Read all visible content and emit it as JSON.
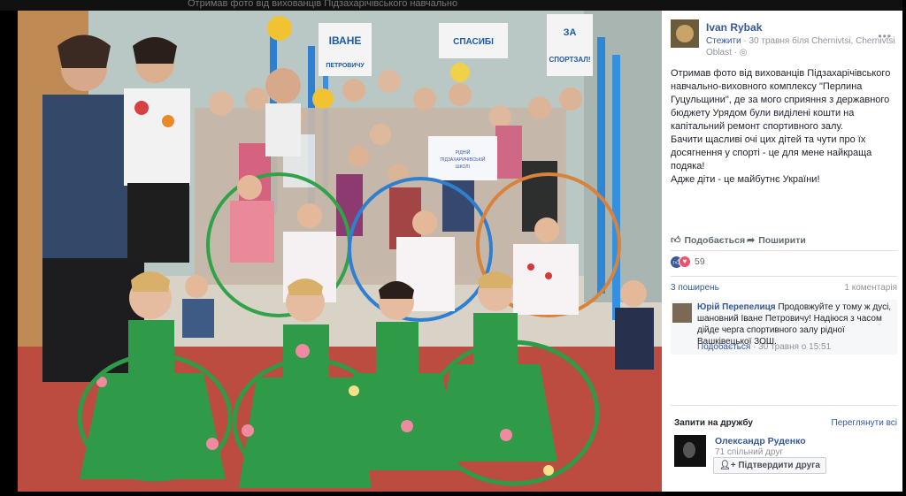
{
  "background_caption": "Отримав фото від вихованців Підзахарічівського навчально",
  "photo": {
    "signs": [
      "ІВАНЕ ПЕТРОВИЧУ",
      "СПАСИБІ",
      "ЗА СПОРТЗАЛ!"
    ],
    "small_sign": "РІДНІЙ ПІДЗАХАРИЧІВСЬКІЙ ШКОЛІ"
  },
  "post": {
    "author": "Ivan Rybak",
    "follow": "Стежити",
    "meta": "· 30 травня біля Chernivtsi, Chernivtsi Oblast ·",
    "paragraphs": [
      "Отримав фото від вихованців Підзахарічівського навчально-виховного комплексу \"Перлина Гуцульщини\", де за мого сприяння з державного бюджету Урядом були виділені кошти на капітальний ремонт спортивного залу.",
      "Бачити щасливі очі цих дітей та чути про їх досягнення у спорті - це для мене найкраща подяка!",
      "Адже діти - це майбутнє України!"
    ],
    "like_label": "Подобається",
    "share_label": "Поширити",
    "reaction_count": "59",
    "shares": "3 поширень",
    "comments": "1 коментарія"
  },
  "comment": {
    "author": "Юрій Перепелиця",
    "text": "Продовжуйте у тому ж дусі, шановний Іване Петровичу! Надіюся з часом дійде черга спортивного залу рідної Вашківецької ЗОШ.",
    "like": "Подобається",
    "time": "· 30 травня о 15:51"
  },
  "friend_requests": {
    "title": "Запити на дружбу",
    "see_all": "Переглянути всі",
    "name": "Олександр Руденко",
    "mutual": "71 спільний друг",
    "confirm": "Підтвердити друга"
  },
  "icons": [
    "like-icon",
    "share-icon",
    "reaction-like-icon",
    "reaction-love-icon",
    "menu-dots-icon",
    "globe-icon",
    "add-friend-icon"
  ]
}
